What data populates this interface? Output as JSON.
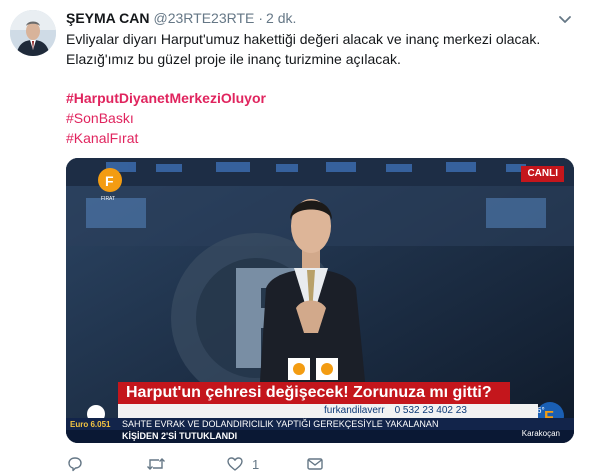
{
  "tweet": {
    "author_name": "ŞEYMA CAN",
    "handle": "@23RTE23RTE",
    "separator": "·",
    "time": "2 dk.",
    "text_line1": "Evliyalar diyarı Harput'umuz hakettiği değeri alacak ve inanç merkezi olacak.",
    "text_line2": "Elazığ'ımız bu güzel proje ile inanç turizmine açılacak.",
    "hashtags": [
      "#HarputDiyanetMerkeziOluyor",
      "#SonBaskı",
      "#KanalFırat"
    ]
  },
  "media": {
    "live_badge": "CANLI",
    "headline": "Harput'un çehresi değişecek! Zorunuza mı gitti?",
    "social_twitter": "furkandilaverr",
    "social_whatsapp": "0 532 23 402 23",
    "ticker_top": "SAHTE EVRAK VE DOLANDIRICILIK YAPTIĞI GEREKÇESİYLE YAKALANAN",
    "ticker_bottom": "KİŞİDEN 2'Sİ TUTUKLANDI",
    "euro": "Euro 6.051",
    "temperature": "6°",
    "city": "Karakoçan"
  },
  "actions": {
    "reply_count": "",
    "retweet_count": "",
    "like_count": "1"
  },
  "colors": {
    "hashtag": "#e0245e",
    "muted": "#657786",
    "text": "#14171a",
    "news_red": "#c4161c"
  },
  "icons": [
    "chevron-down-icon",
    "reply-icon",
    "retweet-icon",
    "heart-icon",
    "mail-icon"
  ]
}
